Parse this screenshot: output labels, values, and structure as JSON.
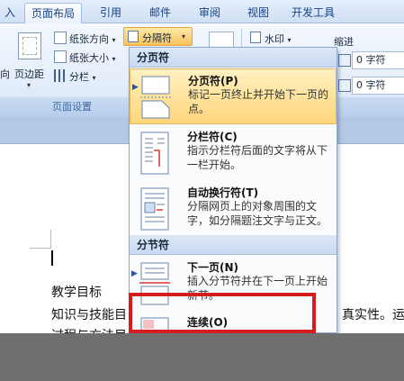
{
  "tabs": [
    {
      "label": "入",
      "active": false
    },
    {
      "label": "页面布局",
      "active": true
    },
    {
      "label": "引用",
      "active": false
    },
    {
      "label": "邮件",
      "active": false
    },
    {
      "label": "审阅",
      "active": false
    },
    {
      "label": "视图",
      "active": false
    },
    {
      "label": "开发工具",
      "active": false
    }
  ],
  "ribbon": {
    "direction_label": "向",
    "margins_label": "页边距",
    "paper_orientation": "纸张方向",
    "paper_size": "纸张大小",
    "columns": "分栏",
    "breaks": "分隔符",
    "watermark": "水印",
    "indent": "缩进",
    "indent_left": "0 字符",
    "indent_right": "0 字符",
    "group_page_setup": "页面设置"
  },
  "menu": {
    "section_page_breaks": "分页符",
    "section_section_breaks": "分节符",
    "items": [
      {
        "title": "分页符(P)",
        "desc": "标记一页终止并开始下一页的点。"
      },
      {
        "title": "分栏符(C)",
        "desc": "指示分栏符后面的文字将从下一栏开始。"
      },
      {
        "title": "自动换行符(T)",
        "desc": "分隔网页上的对象周围的文字，如分隔题注文字与正文。"
      },
      {
        "title": "下一页(N)",
        "desc": "插入分节符并在下一页上开始新节。"
      },
      {
        "title": "连续(O)",
        "desc": ""
      }
    ]
  },
  "document": {
    "line1": "教学目标",
    "line2_left": "知识与技能目",
    "line2_right": "真实性。运",
    "line3": "过程与方法目"
  },
  "colors": {
    "highlight": "#fed67a",
    "annotation": "#d61d1d",
    "ribbon": "#e2ecf9"
  }
}
